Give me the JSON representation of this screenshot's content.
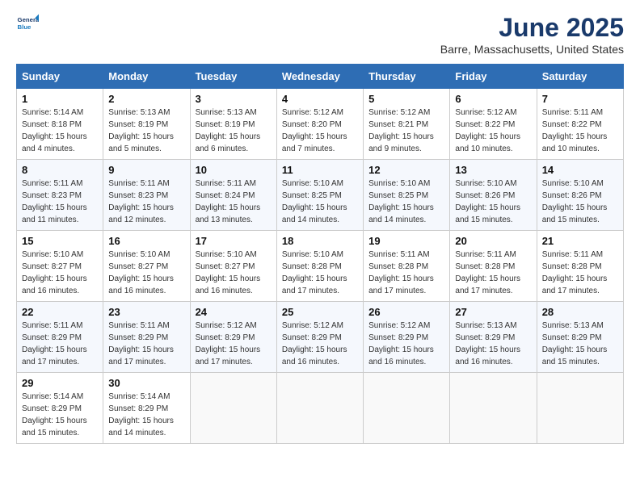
{
  "logo": {
    "line1": "General",
    "line2": "Blue"
  },
  "title": "June 2025",
  "subtitle": "Barre, Massachusetts, United States",
  "days_of_week": [
    "Sunday",
    "Monday",
    "Tuesday",
    "Wednesday",
    "Thursday",
    "Friday",
    "Saturday"
  ],
  "weeks": [
    [
      {
        "num": "1",
        "sunrise": "5:14 AM",
        "sunset": "8:18 PM",
        "daylight": "15 hours and 4 minutes."
      },
      {
        "num": "2",
        "sunrise": "5:13 AM",
        "sunset": "8:19 PM",
        "daylight": "15 hours and 5 minutes."
      },
      {
        "num": "3",
        "sunrise": "5:13 AM",
        "sunset": "8:19 PM",
        "daylight": "15 hours and 6 minutes."
      },
      {
        "num": "4",
        "sunrise": "5:12 AM",
        "sunset": "8:20 PM",
        "daylight": "15 hours and 7 minutes."
      },
      {
        "num": "5",
        "sunrise": "5:12 AM",
        "sunset": "8:21 PM",
        "daylight": "15 hours and 9 minutes."
      },
      {
        "num": "6",
        "sunrise": "5:12 AM",
        "sunset": "8:22 PM",
        "daylight": "15 hours and 10 minutes."
      },
      {
        "num": "7",
        "sunrise": "5:11 AM",
        "sunset": "8:22 PM",
        "daylight": "15 hours and 10 minutes."
      }
    ],
    [
      {
        "num": "8",
        "sunrise": "5:11 AM",
        "sunset": "8:23 PM",
        "daylight": "15 hours and 11 minutes."
      },
      {
        "num": "9",
        "sunrise": "5:11 AM",
        "sunset": "8:23 PM",
        "daylight": "15 hours and 12 minutes."
      },
      {
        "num": "10",
        "sunrise": "5:11 AM",
        "sunset": "8:24 PM",
        "daylight": "15 hours and 13 minutes."
      },
      {
        "num": "11",
        "sunrise": "5:10 AM",
        "sunset": "8:25 PM",
        "daylight": "15 hours and 14 minutes."
      },
      {
        "num": "12",
        "sunrise": "5:10 AM",
        "sunset": "8:25 PM",
        "daylight": "15 hours and 14 minutes."
      },
      {
        "num": "13",
        "sunrise": "5:10 AM",
        "sunset": "8:26 PM",
        "daylight": "15 hours and 15 minutes."
      },
      {
        "num": "14",
        "sunrise": "5:10 AM",
        "sunset": "8:26 PM",
        "daylight": "15 hours and 15 minutes."
      }
    ],
    [
      {
        "num": "15",
        "sunrise": "5:10 AM",
        "sunset": "8:27 PM",
        "daylight": "15 hours and 16 minutes."
      },
      {
        "num": "16",
        "sunrise": "5:10 AM",
        "sunset": "8:27 PM",
        "daylight": "15 hours and 16 minutes."
      },
      {
        "num": "17",
        "sunrise": "5:10 AM",
        "sunset": "8:27 PM",
        "daylight": "15 hours and 16 minutes."
      },
      {
        "num": "18",
        "sunrise": "5:10 AM",
        "sunset": "8:28 PM",
        "daylight": "15 hours and 17 minutes."
      },
      {
        "num": "19",
        "sunrise": "5:11 AM",
        "sunset": "8:28 PM",
        "daylight": "15 hours and 17 minutes."
      },
      {
        "num": "20",
        "sunrise": "5:11 AM",
        "sunset": "8:28 PM",
        "daylight": "15 hours and 17 minutes."
      },
      {
        "num": "21",
        "sunrise": "5:11 AM",
        "sunset": "8:28 PM",
        "daylight": "15 hours and 17 minutes."
      }
    ],
    [
      {
        "num": "22",
        "sunrise": "5:11 AM",
        "sunset": "8:29 PM",
        "daylight": "15 hours and 17 minutes."
      },
      {
        "num": "23",
        "sunrise": "5:11 AM",
        "sunset": "8:29 PM",
        "daylight": "15 hours and 17 minutes."
      },
      {
        "num": "24",
        "sunrise": "5:12 AM",
        "sunset": "8:29 PM",
        "daylight": "15 hours and 17 minutes."
      },
      {
        "num": "25",
        "sunrise": "5:12 AM",
        "sunset": "8:29 PM",
        "daylight": "15 hours and 16 minutes."
      },
      {
        "num": "26",
        "sunrise": "5:12 AM",
        "sunset": "8:29 PM",
        "daylight": "15 hours and 16 minutes."
      },
      {
        "num": "27",
        "sunrise": "5:13 AM",
        "sunset": "8:29 PM",
        "daylight": "15 hours and 16 minutes."
      },
      {
        "num": "28",
        "sunrise": "5:13 AM",
        "sunset": "8:29 PM",
        "daylight": "15 hours and 15 minutes."
      }
    ],
    [
      {
        "num": "29",
        "sunrise": "5:14 AM",
        "sunset": "8:29 PM",
        "daylight": "15 hours and 15 minutes."
      },
      {
        "num": "30",
        "sunrise": "5:14 AM",
        "sunset": "8:29 PM",
        "daylight": "15 hours and 14 minutes."
      },
      null,
      null,
      null,
      null,
      null
    ]
  ],
  "labels": {
    "sunrise": "Sunrise:",
    "sunset": "Sunset:",
    "daylight": "Daylight:"
  }
}
